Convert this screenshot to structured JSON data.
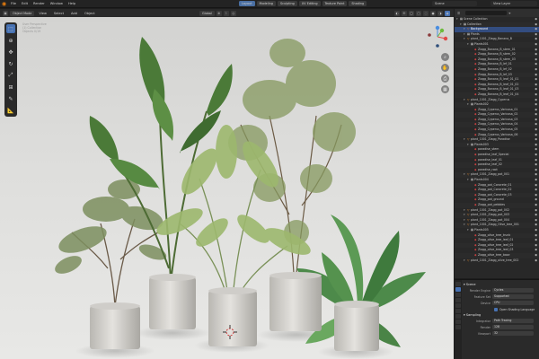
{
  "topbar": {
    "menus": [
      "File",
      "Edit",
      "Render",
      "Window",
      "Help"
    ],
    "workspace_tabs": [
      "Layout",
      "Modeling",
      "Sculpting",
      "UV Editing",
      "Texture Paint",
      "Shading"
    ],
    "scene": "Scene",
    "view_layer": "View Layer"
  },
  "viewport_header": {
    "mode": "Object Mode",
    "menus": [
      "View",
      "Select",
      "Add",
      "Object"
    ],
    "orientation": "Global",
    "options": "Options"
  },
  "viewport_info": [
    "User Perspective",
    "(1) Collection",
    "Objects 0/19"
  ],
  "outliner": {
    "title": "Scene Collection",
    "rows": [
      {
        "label": "Scene Collection",
        "depth": 0,
        "type": "coll",
        "highlight": false
      },
      {
        "label": "Collection",
        "depth": 1,
        "type": "coll",
        "highlight": false
      },
      {
        "label": "Background",
        "depth": 2,
        "type": "obj",
        "highlight": true
      },
      {
        "label": "Plants",
        "depth": 2,
        "type": "coll",
        "highlight": false
      },
      {
        "label": "plant_1001_Ziagg_Banana_B",
        "depth": 2,
        "type": "obj",
        "highlight": false
      },
      {
        "label": "Plants001",
        "depth": 3,
        "type": "coll",
        "highlight": false
      },
      {
        "label": "Ziagg_Banana_B_stem_01",
        "depth": 4,
        "type": "mesh",
        "highlight": false
      },
      {
        "label": "Ziagg_Banana_B_stem_02",
        "depth": 4,
        "type": "mesh",
        "highlight": false
      },
      {
        "label": "Ziagg_Banana_B_stem_03",
        "depth": 4,
        "type": "mesh",
        "highlight": false
      },
      {
        "label": "Ziagg_Banana_B_lef_01",
        "depth": 4,
        "type": "mesh",
        "highlight": false
      },
      {
        "label": "Ziagg_Banana_B_lef_02",
        "depth": 4,
        "type": "mesh",
        "highlight": false
      },
      {
        "label": "Ziagg_Banana_B_lef_03",
        "depth": 4,
        "type": "mesh",
        "highlight": false
      },
      {
        "label": "Ziagg_Banana_B_leaf_01_01",
        "depth": 4,
        "type": "mesh",
        "highlight": false
      },
      {
        "label": "Ziagg_Banana_B_leaf_01_02",
        "depth": 4,
        "type": "mesh",
        "highlight": false
      },
      {
        "label": "Ziagg_Banana_B_leaf_01_03",
        "depth": 4,
        "type": "mesh",
        "highlight": false
      },
      {
        "label": "Ziagg_Banana_B_leaf_01_04",
        "depth": 4,
        "type": "mesh",
        "highlight": false
      },
      {
        "label": "plant_1001_Ziagg_Cyperus",
        "depth": 2,
        "type": "obj",
        "highlight": false
      },
      {
        "label": "Plants002",
        "depth": 3,
        "type": "coll",
        "highlight": false
      },
      {
        "label": "Ziagg_Cyperus_Varicosa_01",
        "depth": 4,
        "type": "mesh",
        "highlight": false
      },
      {
        "label": "Ziagg_Cyperus_Varicosa_02",
        "depth": 4,
        "type": "mesh",
        "highlight": false
      },
      {
        "label": "Ziagg_Cyperus_Varicosa_03",
        "depth": 4,
        "type": "mesh",
        "highlight": false
      },
      {
        "label": "Ziagg_Cyperus_Varicosa_04",
        "depth": 4,
        "type": "mesh",
        "highlight": false
      },
      {
        "label": "Ziagg_Cyperus_Varicosa_05",
        "depth": 4,
        "type": "mesh",
        "highlight": false
      },
      {
        "label": "Ziagg_Cyperus_Varicosa_06",
        "depth": 4,
        "type": "mesh",
        "highlight": false
      },
      {
        "label": "plant_1001_Ziagg_Paradise",
        "depth": 2,
        "type": "obj",
        "highlight": false
      },
      {
        "label": "Plants003",
        "depth": 3,
        "type": "coll",
        "highlight": false
      },
      {
        "label": "paradise_stem",
        "depth": 4,
        "type": "mesh",
        "highlight": false
      },
      {
        "label": "paradise_leaf_Special",
        "depth": 4,
        "type": "mesh",
        "highlight": false
      },
      {
        "label": "paradise_leaf_01",
        "depth": 4,
        "type": "mesh",
        "highlight": false
      },
      {
        "label": "paradise_leaf_02",
        "depth": 4,
        "type": "mesh",
        "highlight": false
      },
      {
        "label": "paradise_root",
        "depth": 4,
        "type": "mesh",
        "highlight": false
      },
      {
        "label": "plant_1001_Ziagg_pot_001",
        "depth": 2,
        "type": "obj",
        "highlight": false
      },
      {
        "label": "Plants004",
        "depth": 3,
        "type": "coll",
        "highlight": false
      },
      {
        "label": "Ziagg_pot_Concrete_01",
        "depth": 4,
        "type": "mesh",
        "highlight": false
      },
      {
        "label": "Ziagg_pot_Concrete_02",
        "depth": 4,
        "type": "mesh",
        "highlight": false
      },
      {
        "label": "Ziagg_pot_Concrete_03",
        "depth": 4,
        "type": "mesh",
        "highlight": false
      },
      {
        "label": "Ziagg_pot_ground",
        "depth": 4,
        "type": "mesh",
        "highlight": false
      },
      {
        "label": "Ziagg_pot_pebbles",
        "depth": 4,
        "type": "mesh",
        "highlight": false
      },
      {
        "label": "plant_1001_Ziagg_pot_002",
        "depth": 2,
        "type": "obj",
        "highlight": false
      },
      {
        "label": "plant_1001_Ziagg_pot_003",
        "depth": 2,
        "type": "obj",
        "highlight": false
      },
      {
        "label": "plant_1001_Ziagg_pot_004",
        "depth": 2,
        "type": "obj",
        "highlight": false
      },
      {
        "label": "plant_1001_Ziagg_Olive_tree_001",
        "depth": 2,
        "type": "obj",
        "highlight": false
      },
      {
        "label": "Plants005",
        "depth": 3,
        "type": "coll",
        "highlight": false
      },
      {
        "label": "Ziagg_olive_tree_trunk",
        "depth": 4,
        "type": "mesh",
        "highlight": false
      },
      {
        "label": "Ziagg_olive_tree_leaf_01",
        "depth": 4,
        "type": "mesh",
        "highlight": false
      },
      {
        "label": "Ziagg_olive_tree_leaf_02",
        "depth": 4,
        "type": "mesh",
        "highlight": false
      },
      {
        "label": "Ziagg_olive_tree_leaf_03",
        "depth": 4,
        "type": "mesh",
        "highlight": false
      },
      {
        "label": "Ziagg_olive_tree_base",
        "depth": 4,
        "type": "mesh",
        "highlight": false
      },
      {
        "label": "plant_1001_Ziagg_olive_tree_002",
        "depth": 2,
        "type": "obj",
        "highlight": false
      }
    ]
  },
  "properties": {
    "section": "Scene",
    "render_engine_label": "Render Engine",
    "render_engine": "Cycles",
    "feature_set_label": "Feature Set",
    "feature_set": "Supported",
    "device_label": "Device",
    "device": "CPU",
    "osl_label": "Open Shading Language",
    "sampling_section": "Sampling",
    "integrator_label": "Integrator",
    "integrator": "Path Tracing",
    "render_label": "Render",
    "render_samples": "128",
    "viewport_label": "Viewport",
    "viewport_samples": "32"
  },
  "colors": {
    "accent_blue": "#4772b3",
    "blender_orange": "#e87d0d",
    "outliner_highlight": "#334d80"
  }
}
